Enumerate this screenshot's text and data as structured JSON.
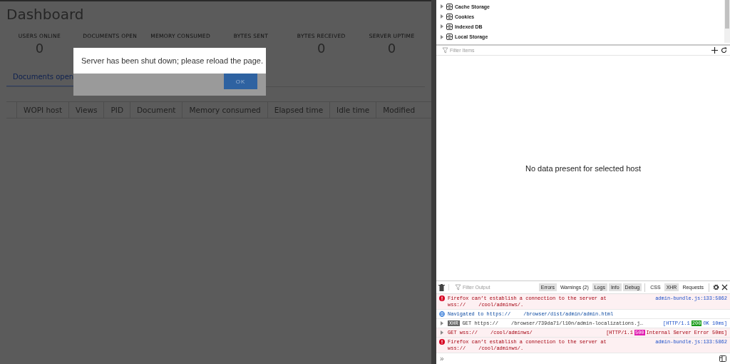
{
  "dashboard": {
    "title": "Dashboard",
    "stats": [
      {
        "label": "USERS ONLINE",
        "value": "0"
      },
      {
        "label": "DOCUMENTS OPEN"
      },
      {
        "label": "MEMORY CONSUMED"
      },
      {
        "label": "BYTES SENT"
      },
      {
        "label": "BYTES RECEIVED",
        "value": "0"
      },
      {
        "label": "SERVER UPTIME",
        "value": "0"
      }
    ],
    "tabs": [
      {
        "label": "Documents open",
        "selected": true
      }
    ],
    "table": {
      "columns": [
        "WOPI host",
        "Views",
        "PID",
        "Document",
        "Memory consumed",
        "Elapsed time",
        "Idle time",
        "Modified"
      ]
    }
  },
  "dialog": {
    "message": "Server has been shut down; please reload the page.",
    "button": "OK"
  },
  "storage": {
    "items": [
      {
        "label": "Cache Storage",
        "expanded": false
      },
      {
        "label": "Cookies",
        "expanded": false
      },
      {
        "label": "Indexed DB",
        "expanded": false
      },
      {
        "label": "Local Storage",
        "expanded": false
      }
    ],
    "filter": {
      "placeholder": "Filter Items"
    },
    "empty_message": "No data present for selected host"
  },
  "console": {
    "filter": {
      "placeholder": "Filter Output"
    },
    "filters": [
      {
        "label": "Errors",
        "selected": true
      },
      {
        "label": "Warnings (2)",
        "selected": false
      },
      {
        "label": "Logs",
        "selected": true
      },
      {
        "label": "Info",
        "selected": true
      },
      {
        "label": "Debug",
        "selected": true
      }
    ],
    "net_filters": [
      {
        "label": "CSS",
        "selected": false
      },
      {
        "label": "XHR",
        "selected": true
      },
      {
        "label": "Requests",
        "selected": false
      }
    ],
    "messages": [
      {
        "kind": "error",
        "lines": [
          [
            "Firefox can’t establish a connection to the server at"
          ],
          [
            "wss://",
            "/cool/adminws/."
          ]
        ],
        "source": "admin-bundle.js:133:5862"
      },
      {
        "kind": "info",
        "lines": [
          [
            "Navigated to https://",
            "/browser/dist/admin/admin.html"
          ]
        ]
      },
      {
        "kind": "xhr",
        "badge": "XHR",
        "lines": [
          [
            "GET https://",
            "/browser/739da71/l10n/admin-localizations.j…"
          ]
        ],
        "protocol": "[HTTP/1.1",
        "code": "200",
        "color": "#1a9c1a",
        "status": "OK 10ms]"
      },
      {
        "kind": "request-error",
        "lines": [
          [
            "GET wss://",
            "/cool/adminws/"
          ]
        ],
        "protocol": "[HTTP/1.1",
        "code": "500",
        "color": "#e01cb0",
        "status": "Internal Server Error 50ms]"
      },
      {
        "kind": "error",
        "lines": [
          [
            "Firefox can’t establish a connection to the server at"
          ],
          [
            "wss://",
            "/cool/adminws/."
          ]
        ],
        "source": "admin-bundle.js:133:5862"
      }
    ],
    "prompt": "»"
  }
}
